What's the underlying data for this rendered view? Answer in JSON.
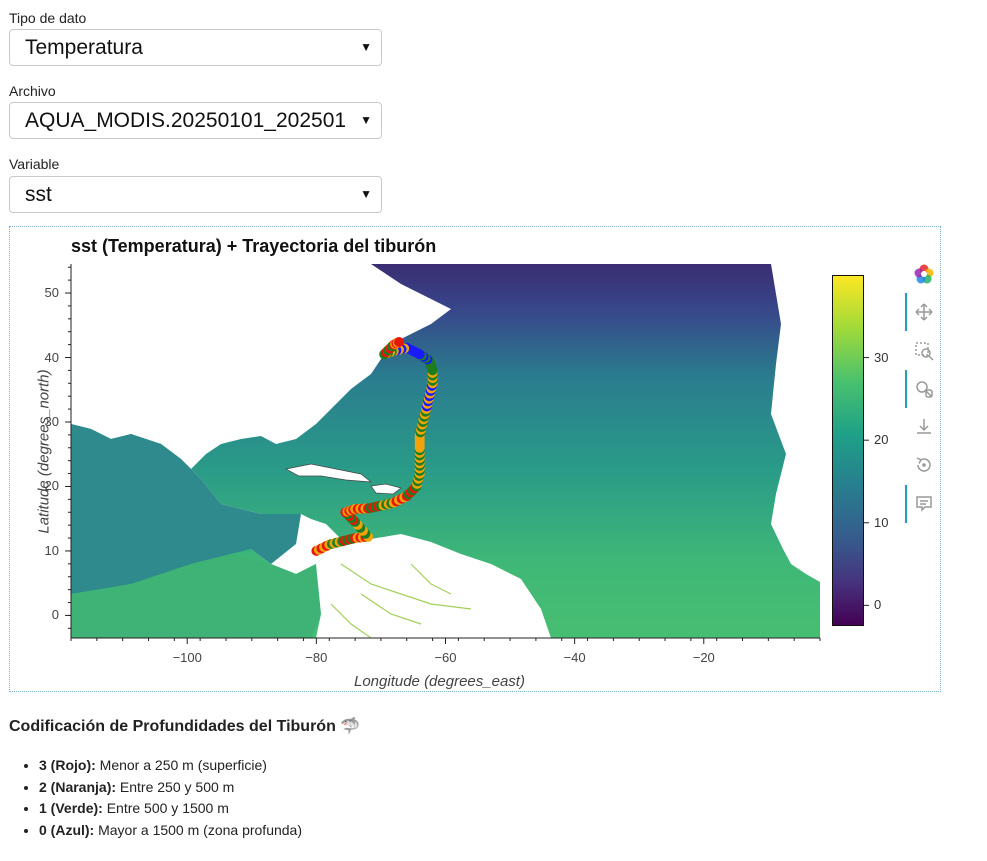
{
  "controls": {
    "data_type": {
      "label": "Tipo de dato",
      "value": "Temperatura"
    },
    "file": {
      "label": "Archivo",
      "value": "AQUA_MODIS.20250101_202501"
    },
    "variable": {
      "label": "Variable",
      "value": "sst"
    }
  },
  "chart_data": {
    "type": "heatmap",
    "title": "sst (Temperatura) + Trayectoria del tiburón",
    "xlabel": "Longitude (degrees_east)",
    "ylabel": "Latitude (degrees_north)",
    "xlim": [
      -118,
      -2
    ],
    "ylim": [
      -3.5,
      54.5
    ],
    "x_ticks": [
      "−100",
      "−80",
      "−60",
      "−40",
      "−20"
    ],
    "x_tick_values": [
      -100,
      -80,
      -60,
      -40,
      -20
    ],
    "y_ticks": [
      "0",
      "10",
      "20",
      "30",
      "40",
      "50"
    ],
    "y_tick_values": [
      0,
      10,
      20,
      30,
      40,
      50
    ],
    "colorbar": {
      "colormap": "viridis",
      "range": [
        -2.5,
        40
      ],
      "ticks": [
        "0",
        "10",
        "20",
        "30"
      ],
      "tick_values": [
        0,
        10,
        20,
        30
      ]
    },
    "depth_colors": {
      "3": "#e8170b",
      "2": "#f2a30c",
      "1": "#1e7d1e",
      "0": "#1a1aff"
    },
    "track": {
      "lon": [
        -80.0,
        -78.0,
        -76.0,
        -74.0,
        -72.0,
        -74.0,
        -75.5,
        -74.0,
        -72.0,
        -70.0,
        -68.0,
        -66.0,
        -64.5,
        -64.0,
        -64.0,
        -64.0,
        -64.0,
        -63.5,
        -63.0,
        -62.5,
        -62.0,
        -62.0,
        -62.5,
        -64.0,
        -66.0,
        -68.0,
        -69.5,
        -68.0,
        -67.0
      ],
      "lat": [
        10.0,
        11.0,
        11.5,
        12.0,
        12.2,
        14.5,
        16.0,
        16.5,
        16.6,
        17.0,
        17.5,
        18.5,
        20.0,
        22.0,
        24.0,
        26.0,
        28.0,
        30.0,
        32.0,
        34.0,
        36.0,
        38.0,
        39.5,
        40.5,
        41.5,
        41.0,
        40.5,
        42.0,
        42.5
      ],
      "depth_code": [
        3,
        2,
        1,
        3,
        2,
        1,
        3,
        2,
        3,
        1,
        2,
        3,
        1,
        2,
        1,
        2,
        2,
        1,
        2,
        0,
        2,
        1,
        1,
        0,
        0,
        2,
        1,
        3,
        2
      ]
    }
  },
  "toolbar": {
    "icons": [
      "bokeh-logo-icon",
      "pan-icon",
      "box-zoom-icon",
      "wheel-zoom-icon",
      "save-icon",
      "reset-icon",
      "hover-icon"
    ]
  },
  "legend": {
    "title": "Codificación de Profundidades del Tiburón 🦈",
    "items": [
      {
        "code": "3 (Rojo):",
        "text": "Menor a 250 m (superficie)"
      },
      {
        "code": "2 (Naranja):",
        "text": "Entre 250 y 500 m"
      },
      {
        "code": "1 (Verde):",
        "text": "Entre 500 y 1500 m"
      },
      {
        "code": "0 (Azul):",
        "text": "Mayor a 1500 m (zona profunda)"
      }
    ]
  }
}
